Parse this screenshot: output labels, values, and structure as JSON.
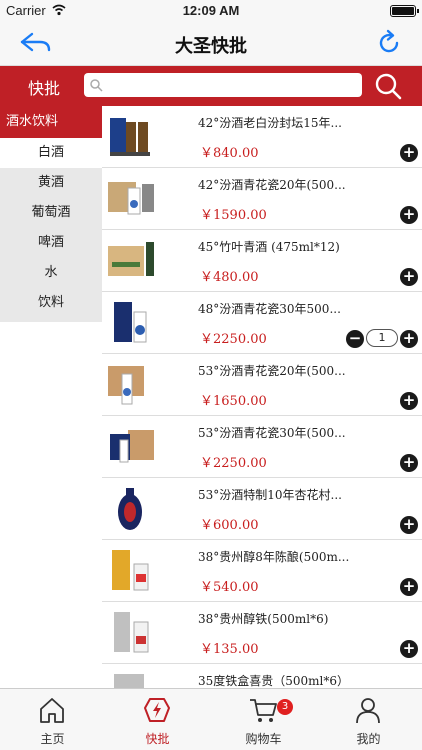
{
  "status_bar": {
    "carrier": "Carrier",
    "time": "12:09 AM"
  },
  "nav": {
    "title": "大圣快批"
  },
  "search": {
    "label": "快批",
    "placeholder": ""
  },
  "sidebar": {
    "header": "酒水饮料",
    "items": [
      {
        "label": "白酒"
      },
      {
        "label": "黄酒"
      },
      {
        "label": "葡萄酒"
      },
      {
        "label": "啤酒"
      },
      {
        "label": "水"
      },
      {
        "label": "饮料"
      }
    ]
  },
  "products": [
    {
      "name": "42°汾酒老白汾封坛15年...",
      "price": "￥840.00"
    },
    {
      "name": "42°汾酒青花瓷20年(500...",
      "price": "￥1590.00"
    },
    {
      "name": "45°竹叶青酒 (475ml*12)",
      "price": "￥480.00"
    },
    {
      "name": "48°汾酒青花瓷30年500...",
      "price": "￥2250.00",
      "qty": "1"
    },
    {
      "name": "53°汾酒青花瓷20年(500...",
      "price": "￥1650.00"
    },
    {
      "name": "53°汾酒青花瓷30年(500...",
      "price": "￥2250.00"
    },
    {
      "name": "53°汾酒特制10年杏花村...",
      "price": "￥600.00"
    },
    {
      "name": "38°贵州醇8年陈酿(500m...",
      "price": "￥540.00"
    },
    {
      "name": "38°贵州醇铁(500ml*6)",
      "price": "￥135.00"
    },
    {
      "name": "35度铁盒喜贵（500ml*6）",
      "price": ""
    }
  ],
  "tabs": [
    {
      "label": "主页"
    },
    {
      "label": "快批"
    },
    {
      "label": "购物车",
      "badge": "3"
    },
    {
      "label": "我的"
    }
  ],
  "colors": {
    "accent": "#bf2026",
    "price": "#c81e1e",
    "ios_blue": "#1a7cf5"
  }
}
